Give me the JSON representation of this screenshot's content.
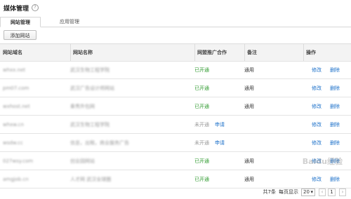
{
  "page": {
    "title": "媒体管理",
    "help_icon": "?"
  },
  "tabs": [
    {
      "label": "网站管理",
      "active": true
    },
    {
      "label": "应用管理",
      "active": false
    }
  ],
  "toolbar": {
    "add_label": "添加网站"
  },
  "table": {
    "columns": [
      "网站域名",
      "网站名称",
      "网盟推广合作",
      "备注",
      "操作"
    ],
    "rows": [
      {
        "domain": "whxx.net",
        "name": "武汉生物工程学院",
        "status": "已开通",
        "apply": "",
        "note": "通用",
        "edit": "修改",
        "delete": "删除"
      },
      {
        "domain": "pm07.com",
        "name": "武汉广告设计师网站",
        "status": "已开通",
        "apply": "",
        "note": "通用",
        "edit": "修改",
        "delete": "删除"
      },
      {
        "domain": "wxhost.net",
        "name": "秦秀外包网",
        "status": "已开通",
        "apply": "",
        "note": "通用",
        "edit": "修改",
        "delete": "删除"
      },
      {
        "domain": "whxw.cn",
        "name": "武汉生物工程学院",
        "status": "未开通",
        "apply": "申请",
        "note": "",
        "edit": "修改",
        "delete": "删除"
      },
      {
        "domain": "wsdw.cc",
        "name": "信息，出租，商业服务广告",
        "status": "未开通",
        "apply": "申请",
        "note": "",
        "edit": "修改",
        "delete": "删除"
      },
      {
        "domain": "027wsy.com",
        "name": "创业园网站",
        "status": "已开通",
        "apply": "",
        "note": "通用",
        "edit": "修改",
        "delete": "删除"
      },
      {
        "domain": "amgjob.cn",
        "name": "人才网 武汉全球圈",
        "status": "已开通",
        "apply": "",
        "note": "通用",
        "edit": "修改",
        "delete": "删除"
      }
    ]
  },
  "footer": {
    "total": "共7条",
    "per_page_label": "每页显示",
    "per_page": "20",
    "prev": "‹",
    "page": "1",
    "next": "›"
  },
  "watermark": "Baidu经验"
}
